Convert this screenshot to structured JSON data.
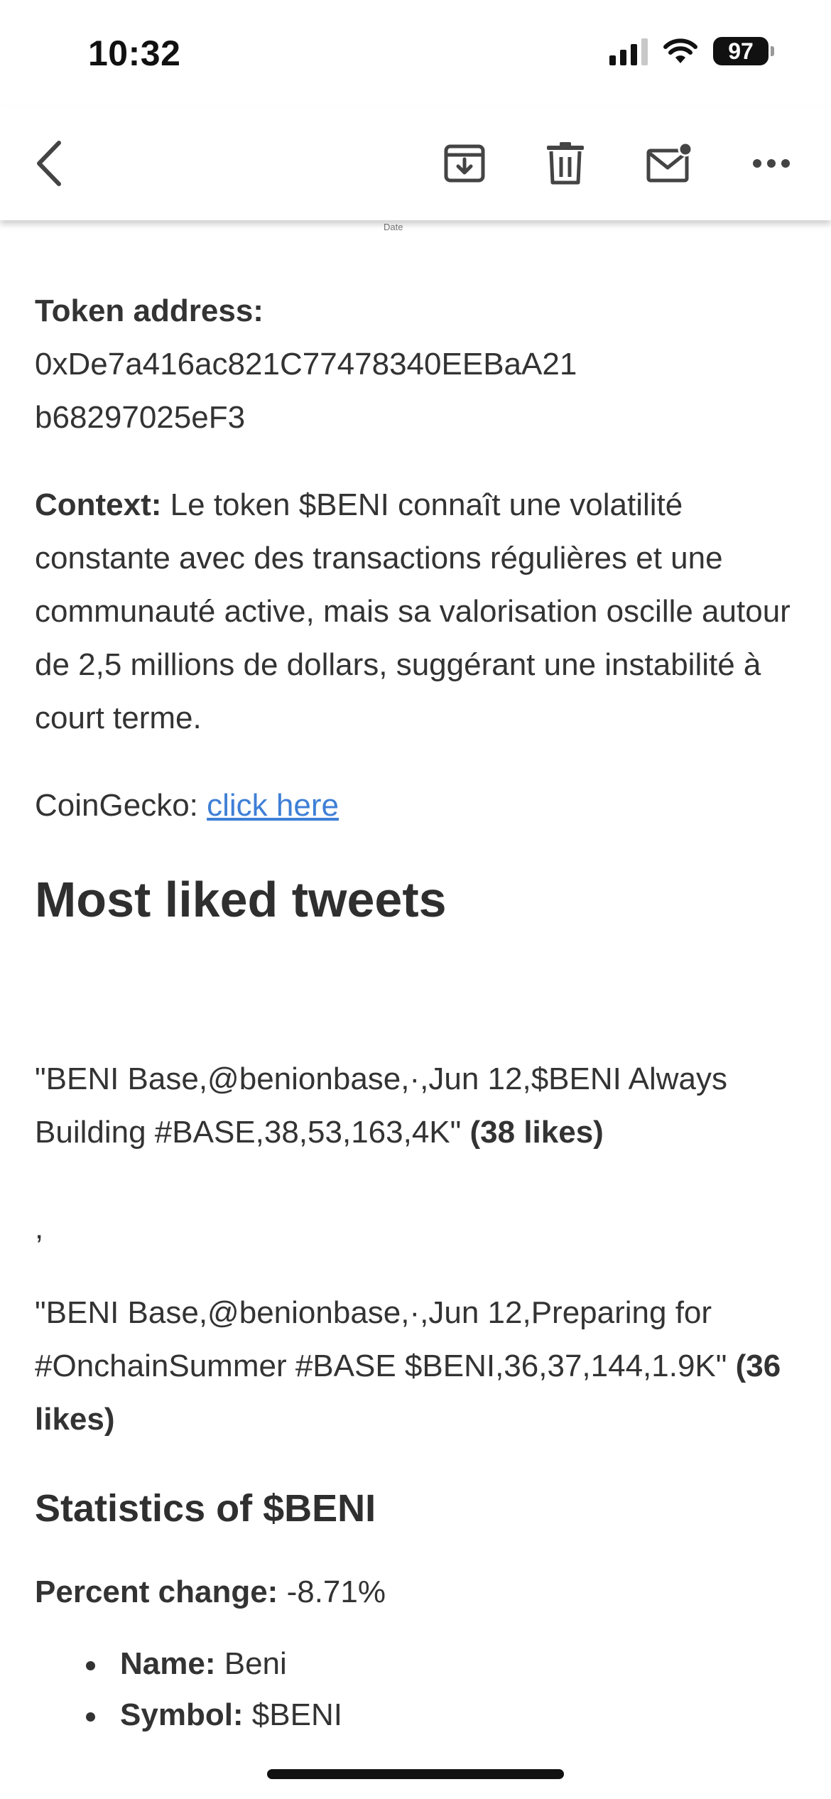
{
  "status_bar": {
    "time": "10:32",
    "battery": "97"
  },
  "toolbar": {
    "icons": [
      "back-icon",
      "archive-icon",
      "trash-icon",
      "mark-unread-icon",
      "more-icon"
    ]
  },
  "header": {
    "date_label": "Date"
  },
  "token": {
    "address_label": "Token address:",
    "address_line1": "0xDe7a416ac821C77478340EEBaA21",
    "address_line2": "b68297025eF3"
  },
  "context": {
    "label": "Context:",
    "text": " Le token $BENI connaît une volatilité constante avec des transactions régulières et une communauté active, mais sa valorisation oscille autour de 2,5 millions de dollars, suggérant une instabilité à court terme."
  },
  "coingecko": {
    "label": "CoinGecko: ",
    "link_text": "click here"
  },
  "tweets": {
    "heading": "Most liked tweets",
    "items": [
      {
        "text": "\"BENI Base,@benionbase,·,Jun 12,$BENI Always Building #BASE,38,53,163,4K\" ",
        "likes": "(38 likes)"
      },
      {
        "text": "\"BENI Base,@benionbase,·,Jun 12,Preparing for #OnchainSummer #BASE $BENI,36,37,144,1.9K\" ",
        "likes": "(36 likes)"
      }
    ],
    "separator": ","
  },
  "statistics": {
    "heading": "Statistics of $BENI",
    "percent_label": "Percent change:",
    "percent_value": " -8.71%",
    "items": [
      {
        "label": "Name:",
        "value": " Beni"
      },
      {
        "label": "Symbol:",
        "value": " $BENI"
      }
    ]
  },
  "colors": {
    "link": "#3f7fd6",
    "text": "#333333",
    "background": "#ffffff"
  }
}
